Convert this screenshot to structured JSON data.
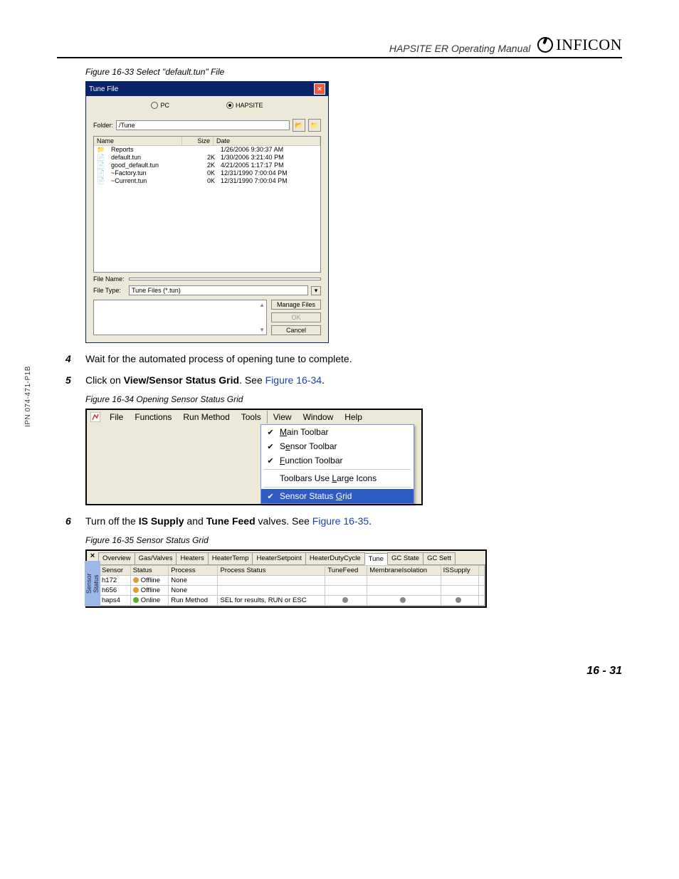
{
  "header": {
    "doc_title": "HAPSITE ER Operating Manual",
    "brand": "INFICON"
  },
  "side_note": "IPN 074-471-P1B",
  "fig33": {
    "caption": "Figure 16-33  Select \"default.tun\" File",
    "title": "Tune File",
    "radio_pc": "PC",
    "radio_haps": "HAPSITE",
    "folder_label": "Folder:",
    "folder_value": "/Tune",
    "col_name": "Name",
    "col_size": "Size",
    "col_date": "Date",
    "rows": [
      {
        "ico": "📁",
        "name": "Reports",
        "size": "",
        "date": "1/26/2006 9:30:37 AM"
      },
      {
        "ico": "📄",
        "name": "default.tun",
        "size": "2K",
        "date": "1/30/2006 3:21:40 PM"
      },
      {
        "ico": "📄",
        "name": "good_default.tun",
        "size": "2K",
        "date": "4/21/2005 1:17:17 PM"
      },
      {
        "ico": "📄",
        "name": "~Factory.tun",
        "size": "0K",
        "date": "12/31/1990 7:00:04 PM"
      },
      {
        "ico": "📄",
        "name": "~Current.tun",
        "size": "0K",
        "date": "12/31/1990 7:00:04 PM"
      }
    ],
    "filename_label": "File Name:",
    "filetype_label": "File Type:",
    "filetype_value": "Tune Files (*.tun)",
    "btn_manage": "Manage Files",
    "btn_ok": "OK",
    "btn_cancel": "Cancel"
  },
  "step4": {
    "num": "4",
    "txt": "Wait for the automated process of opening tune to complete."
  },
  "step5": {
    "num": "5",
    "pre": "Click on ",
    "bold": "View/Sensor Status Grid",
    "post": ". See ",
    "link": "Figure 16-34",
    "end": "."
  },
  "fig34": {
    "caption": "Figure 16-34  Opening Sensor Status Grid",
    "menu": [
      "File",
      "Functions",
      "Run Method",
      "Tools",
      "View",
      "Window",
      "Help"
    ],
    "items": {
      "main": "Main Toolbar",
      "main_u": "M",
      "sensor": "Sensor Toolbar",
      "sensor_u": "e",
      "func": "Function Toolbar",
      "func_u": "F",
      "large": "Toolbars Use Large Icons",
      "large_u": "L",
      "grid": "Sensor Status Grid",
      "grid_u": "G"
    }
  },
  "step6": {
    "num": "6",
    "pre": "Turn off the ",
    "b1": "IS Supply",
    "mid": " and ",
    "b2": "Tune Feed",
    "post": " valves. See ",
    "link": "Figure 16-35",
    "end": "."
  },
  "fig35": {
    "caption": "Figure 16-35  Sensor Status Grid",
    "side_label": "Sensor Status",
    "close": "×",
    "tabs": [
      "Overview",
      "Gas/Valves",
      "Heaters",
      "HeaterTemp",
      "HeaterSetpoint",
      "HeaterDutyCycle",
      "Tune",
      "GC State",
      "GC Sett"
    ],
    "active_tab": "Tune",
    "cols": [
      "Sensor",
      "Status",
      "Process",
      "Process Status",
      "TuneFeed",
      "MembraneIsolation",
      "ISSupply",
      ""
    ],
    "rows": [
      {
        "sensor": "h172",
        "status": "Offline",
        "dot": "orange",
        "process": "None",
        "pstatus": "",
        "tf": "",
        "mi": "",
        "is": ""
      },
      {
        "sensor": "h656",
        "status": "Offline",
        "dot": "orange",
        "process": "None",
        "pstatus": "",
        "tf": "",
        "mi": "",
        "is": ""
      },
      {
        "sensor": "haps4",
        "status": "Online",
        "dot": "green",
        "process": "Run Method",
        "pstatus": "SEL for results, RUN or ESC",
        "tf": "gray",
        "mi": "gray",
        "is": "gray"
      }
    ]
  },
  "footer": "16 - 31"
}
